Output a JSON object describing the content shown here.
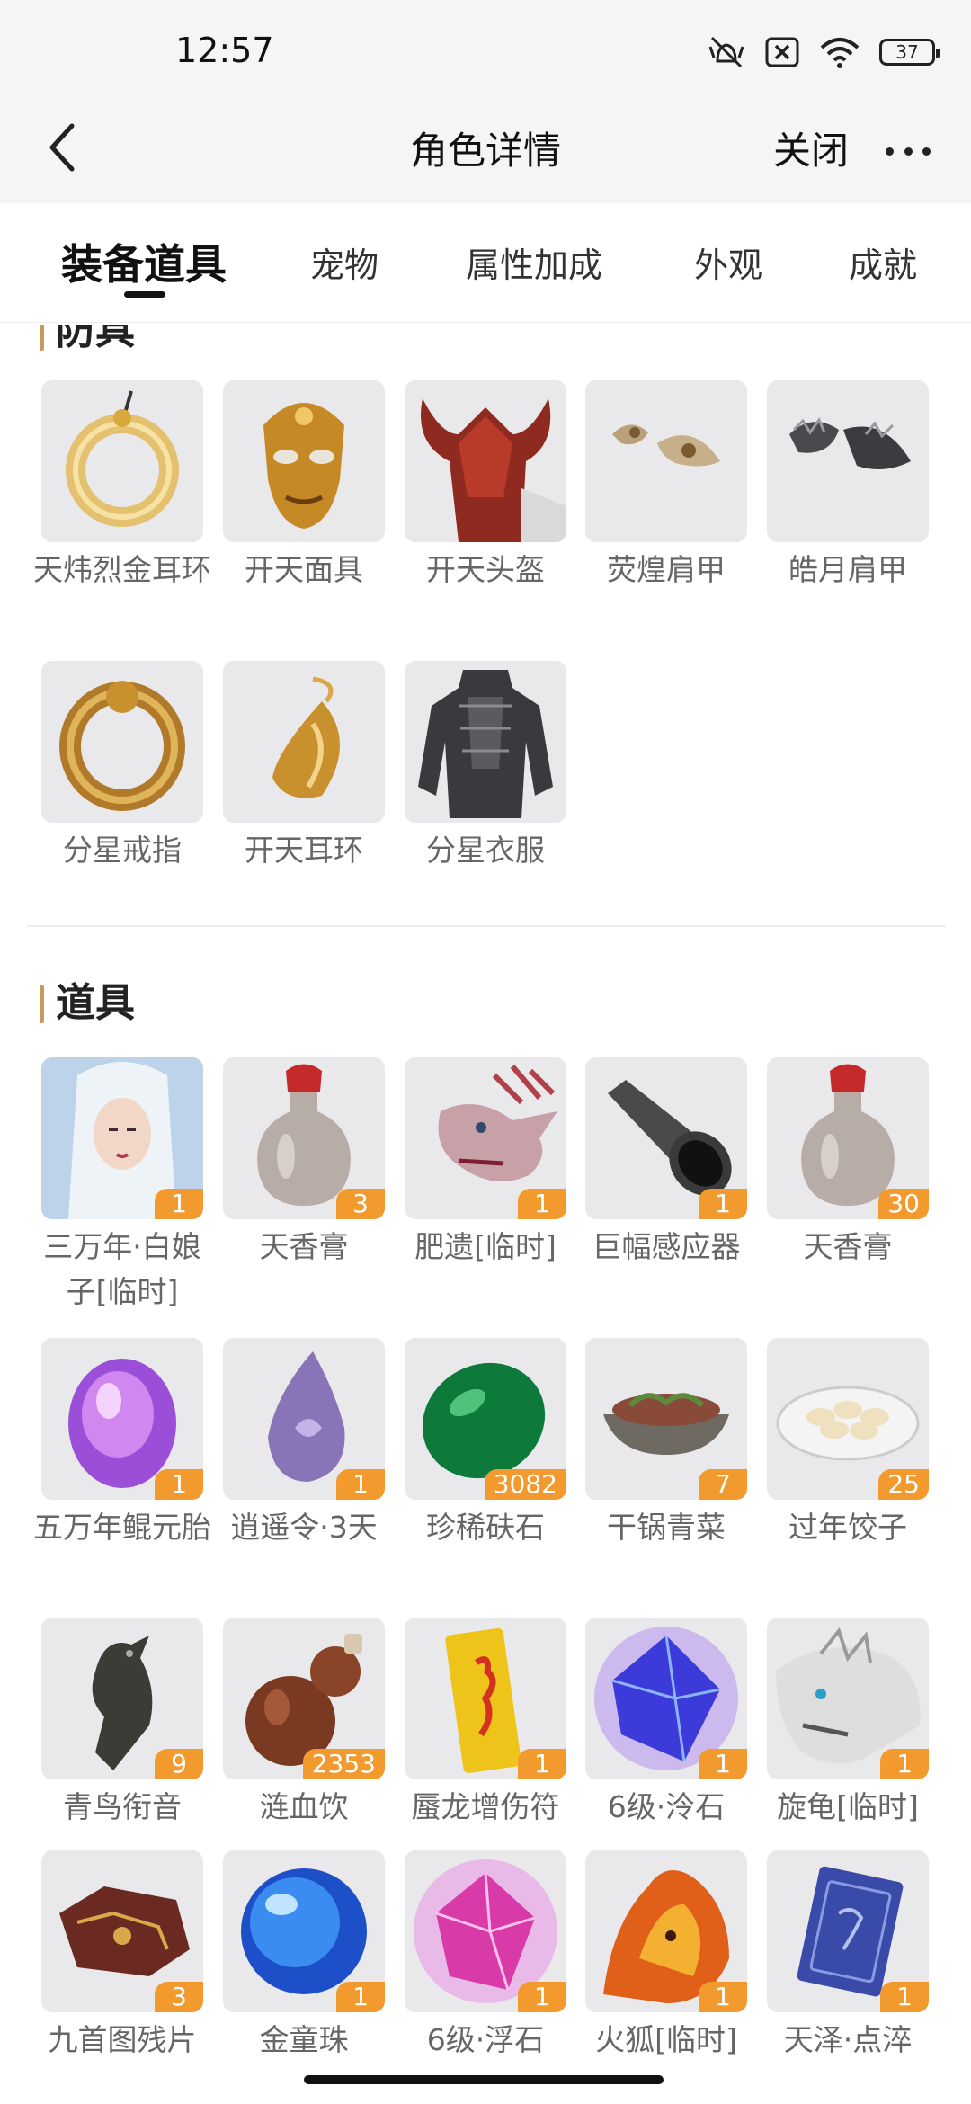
{
  "status_bar": {
    "time": "12:57",
    "battery": "37"
  },
  "nav": {
    "title": "角色详情",
    "close_label": "关闭"
  },
  "tabs": [
    {
      "label": "装备道具",
      "active": true
    },
    {
      "label": "宠物"
    },
    {
      "label": "属性加成"
    },
    {
      "label": "外观"
    },
    {
      "label": "成就"
    }
  ],
  "armor_section": {
    "title": "防具",
    "items": [
      {
        "name": "天炜烈金耳环",
        "icon": "gold-ring-earring-icon"
      },
      {
        "name": "开天面具",
        "icon": "gold-mask-icon"
      },
      {
        "name": "开天头盔",
        "icon": "red-horned-helmet-icon"
      },
      {
        "name": "荧煌肩甲",
        "icon": "shoulder-armor-icon"
      },
      {
        "name": "皓月肩甲",
        "icon": "dark-shoulder-armor-icon"
      },
      {
        "name": "分星戒指",
        "icon": "gold-ring-icon"
      },
      {
        "name": "开天耳环",
        "icon": "gold-earring-icon"
      },
      {
        "name": "分星衣服",
        "icon": "dark-armor-clothes-icon"
      }
    ]
  },
  "items_section": {
    "title": "道具",
    "items": [
      {
        "name": "三万年·白娘子[临时]",
        "count": "1",
        "icon": "white-lady-portrait-icon"
      },
      {
        "name": "天香膏",
        "count": "3",
        "icon": "potion-bottle-icon"
      },
      {
        "name": "肥遗[临时]",
        "count": "1",
        "icon": "dragon-head-icon"
      },
      {
        "name": "巨幅感应器",
        "count": "1",
        "icon": "dark-horn-icon"
      },
      {
        "name": "天香膏",
        "count": "30",
        "icon": "potion-bottle-icon"
      },
      {
        "name": "五万年鲲元胎",
        "count": "1",
        "icon": "purple-egg-icon"
      },
      {
        "name": "逍遥令·3天",
        "count": "1",
        "icon": "purple-token-icon"
      },
      {
        "name": "珍稀砆石",
        "count": "3082",
        "icon": "green-stone-icon"
      },
      {
        "name": "干锅青菜",
        "count": "7",
        "icon": "food-bowl-icon"
      },
      {
        "name": "过年饺子",
        "count": "25",
        "icon": "dumplings-plate-icon"
      },
      {
        "name": "青鸟衔音",
        "count": "9",
        "icon": "bird-whistle-icon"
      },
      {
        "name": "涟血饮",
        "count": "2353",
        "icon": "gourd-icon"
      },
      {
        "name": "蜃龙增伤符",
        "count": "1",
        "icon": "yellow-talisman-icon"
      },
      {
        "name": "6级·泠石",
        "count": "1",
        "icon": "blue-crystal-icon"
      },
      {
        "name": "旋龟[临时]",
        "count": "1",
        "icon": "white-beast-icon"
      },
      {
        "name": "九首图残片",
        "count": "3",
        "icon": "map-fragment-icon"
      },
      {
        "name": "金童珠",
        "count": "1",
        "icon": "blue-orb-icon"
      },
      {
        "name": "6级·浮石",
        "count": "1",
        "icon": "pink-crystal-icon"
      },
      {
        "name": "火狐[临时]",
        "count": "1",
        "icon": "fire-fox-icon"
      },
      {
        "name": "天泽·点淬",
        "count": "1",
        "icon": "blue-book-icon"
      }
    ]
  }
}
